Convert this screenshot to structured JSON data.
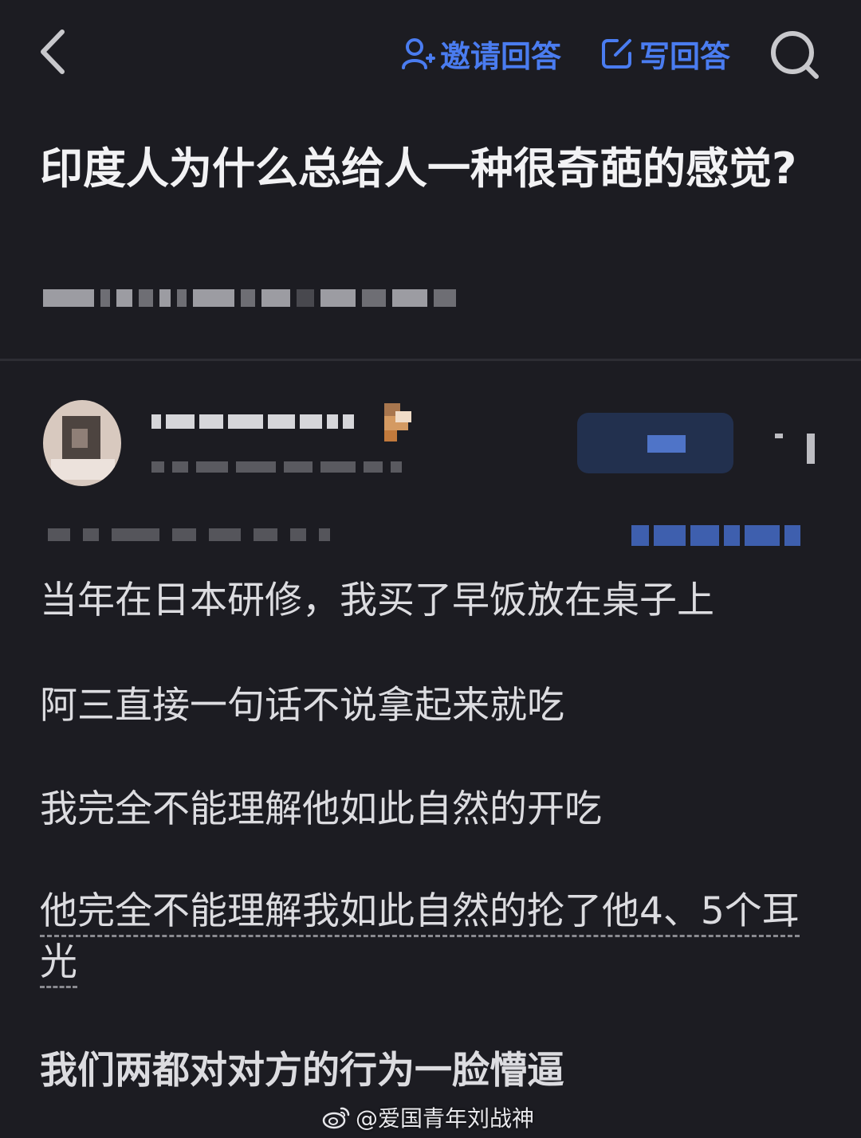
{
  "header": {
    "invite_answer_label": "邀请回答",
    "write_answer_label": "写回答",
    "accent_color": "#4a7cf0"
  },
  "question": {
    "title": "印度人为什么总给人一种很奇葩的感觉?"
  },
  "answer": {
    "paragraphs": [
      "当年在日本研修，我买了早饭放在桌子上",
      "阿三直接一句话不说拿起来就吃",
      "我完全不能理解他如此自然的开吃",
      "他完全不能理解我如此自然的抡了他4、5个耳光",
      "我们两都对对方的行为一脸懵逼"
    ]
  },
  "watermark": {
    "text": "@爱国青年刘战神"
  },
  "icons": {
    "back": "chevron-left-icon",
    "invite": "person-add-icon",
    "write": "edit-icon",
    "search": "search-icon",
    "watermark": "weibo-icon"
  }
}
